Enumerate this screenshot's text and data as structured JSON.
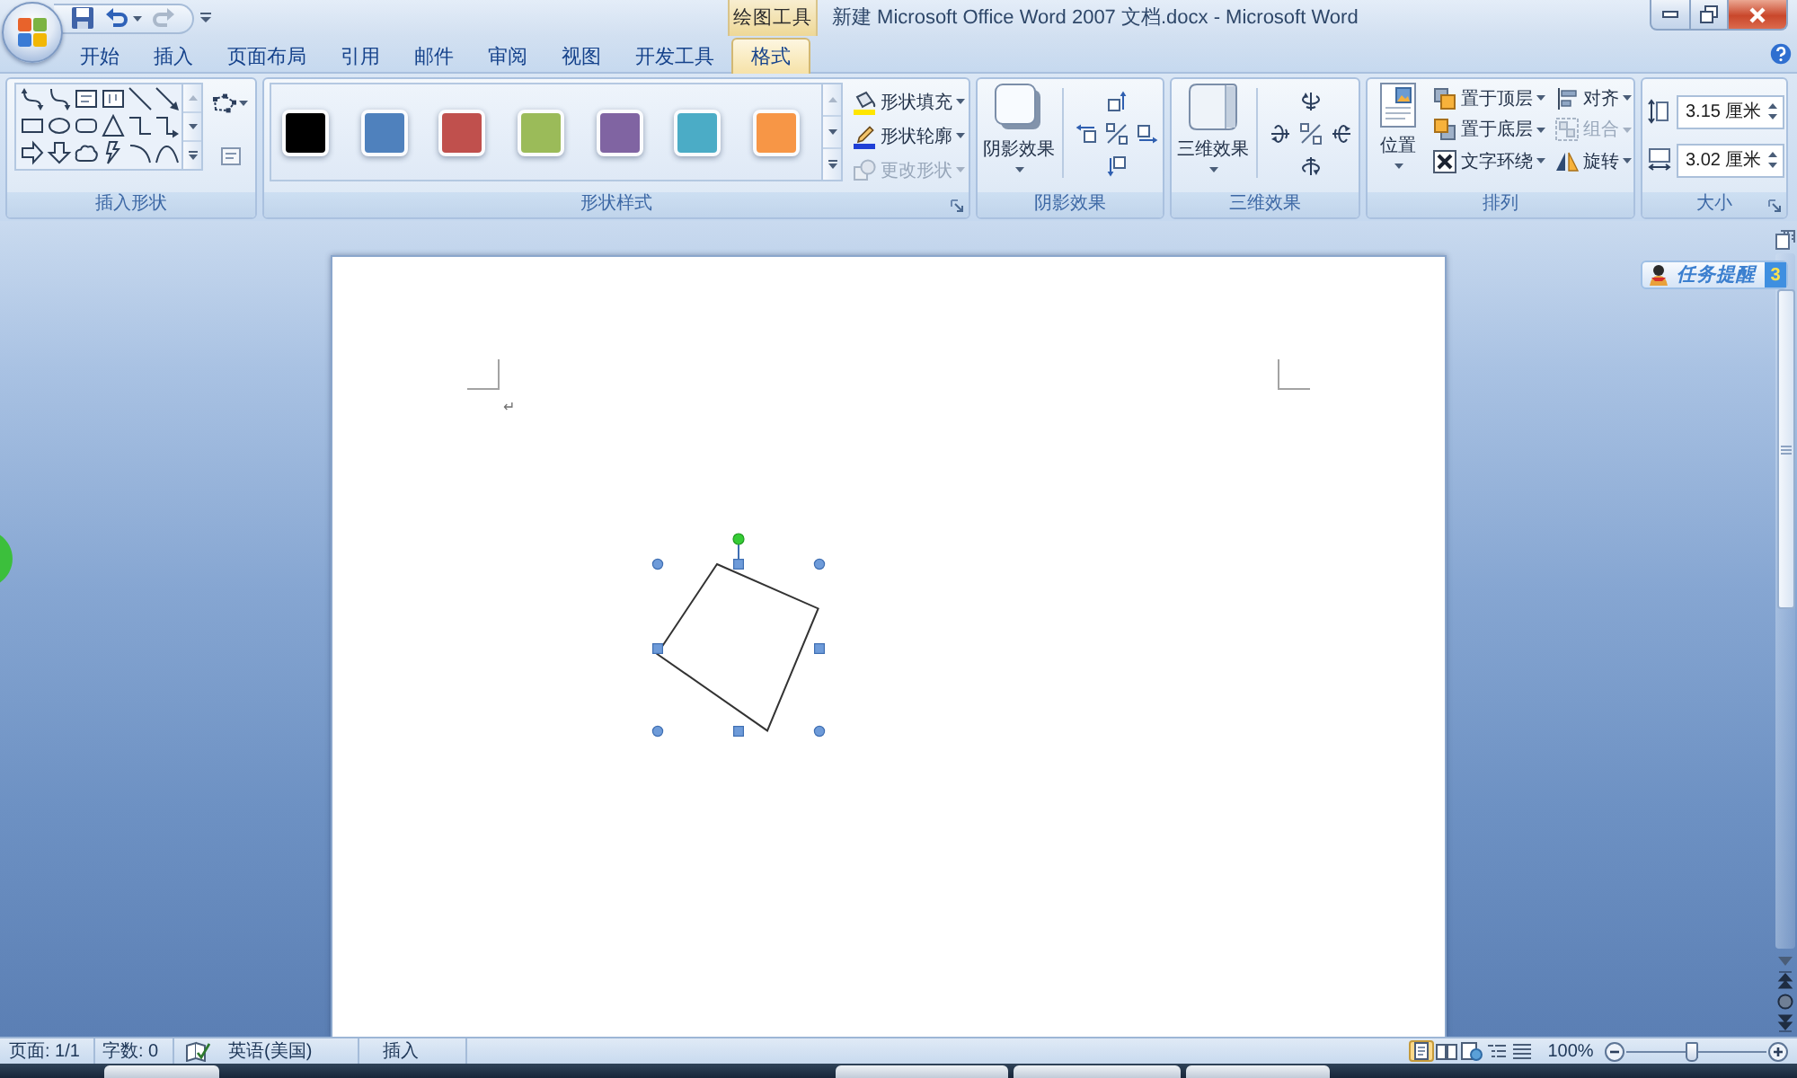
{
  "window": {
    "title": "新建 Microsoft Office Word 2007 文档.docx - Microsoft Word",
    "context_tab_group": "绘图工具"
  },
  "quick_access": [
    {
      "kind": "save",
      "disabled": false
    },
    {
      "kind": "undo",
      "disabled": false
    },
    {
      "kind": "redo",
      "disabled": true
    }
  ],
  "tabs": [
    {
      "label": "开始",
      "selected": false
    },
    {
      "label": "插入",
      "selected": false
    },
    {
      "label": "页面布局",
      "selected": false
    },
    {
      "label": "引用",
      "selected": false
    },
    {
      "label": "邮件",
      "selected": false
    },
    {
      "label": "审阅",
      "selected": false
    },
    {
      "label": "视图",
      "selected": false
    },
    {
      "label": "开发工具",
      "selected": false
    },
    {
      "label": "格式",
      "selected": true
    }
  ],
  "ribbon": {
    "insert_shapes": {
      "label": "插入形状"
    },
    "shape_styles": {
      "label": "形状样式",
      "swatches": [
        {
          "color": "#000000"
        },
        {
          "color": "#4f81bd"
        },
        {
          "color": "#c0504d"
        },
        {
          "color": "#9bbb59"
        },
        {
          "color": "#8064a2"
        },
        {
          "color": "#4bacc6"
        },
        {
          "color": "#f79646"
        }
      ],
      "commands": [
        {
          "kind": "fill",
          "label": "形状填充",
          "disabled": false
        },
        {
          "kind": "outline",
          "label": "形状轮廓",
          "disabled": false
        },
        {
          "kind": "change_shape",
          "label": "更改形状",
          "disabled": true
        }
      ]
    },
    "shadow_effects": {
      "label": "阴影效果",
      "button": "阴影效果"
    },
    "three_d_effects": {
      "label": "三维效果",
      "button": "三维效果"
    },
    "arrange": {
      "label": "排列",
      "position_button": "位置",
      "commands": [
        {
          "kind": "bring_to_front",
          "label": "置于顶层",
          "disabled": false
        },
        {
          "kind": "send_to_back",
          "label": "置于底层",
          "disabled": false
        },
        {
          "kind": "text_wrapping",
          "label": "文字环绕",
          "disabled": false
        },
        {
          "kind": "align",
          "label": "对齐",
          "disabled": false
        },
        {
          "kind": "group",
          "label": "组合",
          "disabled": true
        },
        {
          "kind": "rotate",
          "label": "旋转",
          "disabled": false
        }
      ]
    },
    "size": {
      "label": "大小",
      "fields": [
        {
          "kind": "height",
          "value": "3.15 厘米"
        },
        {
          "kind": "width",
          "value": "3.02 厘米"
        }
      ]
    }
  },
  "document": {
    "paragraph_mark": "↵",
    "shape": {
      "selected": true
    }
  },
  "task_reminder": {
    "label": "任务提醒",
    "count": "3"
  },
  "status_bar": {
    "page": "页面: 1/1",
    "words": "字数: 0",
    "language": "英语(美国)",
    "mode": "插入",
    "views": [
      {
        "kind": "print_layout",
        "selected": true
      },
      {
        "kind": "full_screen_reading",
        "selected": false
      },
      {
        "kind": "web_layout",
        "selected": false
      },
      {
        "kind": "outline",
        "selected": false
      },
      {
        "kind": "draft",
        "selected": false
      }
    ],
    "zoom": "100%",
    "zoom_slider": {
      "level": 0.47
    }
  }
}
